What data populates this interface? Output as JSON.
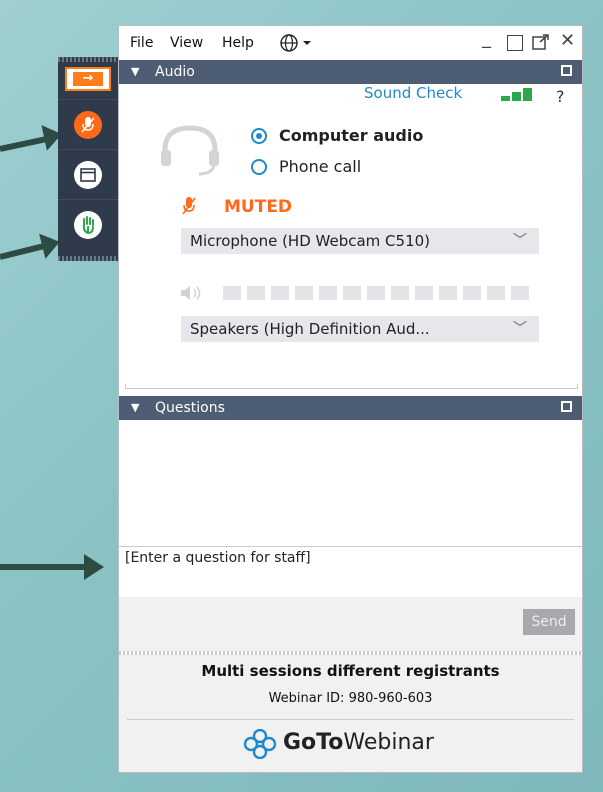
{
  "menu": {
    "file": "File",
    "view": "View",
    "help": "Help"
  },
  "audio": {
    "section_title": "Audio",
    "sound_check": "Sound Check",
    "help_mark": "?",
    "computer_audio": "Computer audio",
    "phone_call": "Phone call",
    "selected_mode": "Computer audio",
    "muted_label": "MUTED",
    "microphone": "Microphone (HD Webcam C510)",
    "speakers": "Speakers (High Definition Aud..."
  },
  "questions": {
    "section_title": "Questions",
    "placeholder": "[Enter a question for staff]",
    "send": "Send"
  },
  "session": {
    "title": "Multi sessions different registrants",
    "webinar_id": "Webinar ID: 980-960-603",
    "brand_bold": "GoTo",
    "brand_light": "Webinar"
  },
  "colors": {
    "accent_orange": "#ff7e1a",
    "link_blue": "#1f8ac9",
    "bar_green": "#2aa84a",
    "header_slate": "#4d5d73"
  },
  "icons": [
    "show-panel-arrow-icon",
    "mic-muted-icon",
    "window-icon",
    "raise-hand-icon",
    "headset-icon",
    "speaker-icon",
    "globe-icon",
    "minimize-icon",
    "maximize-icon",
    "popout-icon",
    "close-icon"
  ]
}
